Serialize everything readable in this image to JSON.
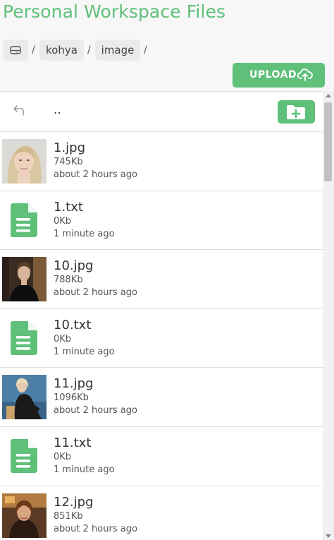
{
  "header": {
    "title": "Personal Workspace Files",
    "breadcrumb": {
      "home_icon": "drive-icon",
      "items": [
        "kohya",
        "image"
      ],
      "separator": "/"
    },
    "upload_label": "UPLOAD",
    "upload_icon": "cloud-upload-icon"
  },
  "list": {
    "parent_label": "..",
    "back_icon": "back-arrow-icon",
    "new_folder_icon": "folder-plus-icon",
    "files": [
      {
        "name": "1.jpg",
        "size": "745Kb",
        "modified": "about 2 hours ago",
        "type": "image"
      },
      {
        "name": "1.txt",
        "size": "0Kb",
        "modified": "1 minute ago",
        "type": "text"
      },
      {
        "name": "10.jpg",
        "size": "788Kb",
        "modified": "about 2 hours ago",
        "type": "image"
      },
      {
        "name": "10.txt",
        "size": "0Kb",
        "modified": "1 minute ago",
        "type": "text"
      },
      {
        "name": "11.jpg",
        "size": "1096Kb",
        "modified": "about 2 hours ago",
        "type": "image"
      },
      {
        "name": "11.txt",
        "size": "0Kb",
        "modified": "1 minute ago",
        "type": "text"
      },
      {
        "name": "12.jpg",
        "size": "851Kb",
        "modified": "about 2 hours ago",
        "type": "image"
      }
    ]
  },
  "colors": {
    "accent": "#5fc07a",
    "background": "#f7f7f7",
    "row_border": "#dddddd"
  }
}
